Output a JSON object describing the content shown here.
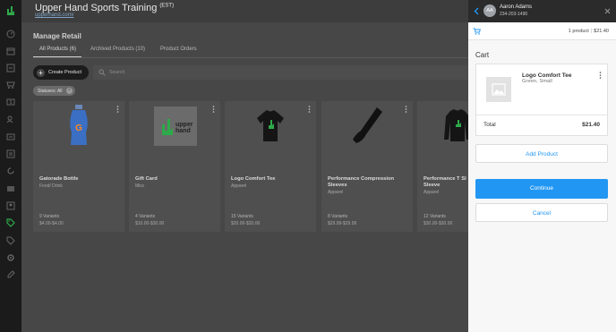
{
  "app": {
    "title": "Upper Hand Sports Training",
    "timezone": "(EST)",
    "url": "upperhand.com/"
  },
  "page": {
    "title": "Manage Retail",
    "tabs": [
      {
        "label": "All Products (6)",
        "active": true
      },
      {
        "label": "Archived Products (10)",
        "active": false
      },
      {
        "label": "Product Orders",
        "active": false
      }
    ],
    "create_button": "Create Product",
    "search_placeholder": "Search",
    "filter_chip": "Statuses: All"
  },
  "products": [
    {
      "name": "Gatorade Bottle",
      "category": "Food/ Drink",
      "variants": "9 Variants",
      "price": "$4.00-$4.00",
      "image": "bottle"
    },
    {
      "name": "Gift Card",
      "category": "Misc",
      "variants": "4 Variants",
      "price": "$10.00-$30.00",
      "image": "logo"
    },
    {
      "name": "Logo Comfort Tee",
      "category": "Apparel",
      "variants": "15 Variants",
      "price": "$20.00-$20.00",
      "image": "tee"
    },
    {
      "name": "Performance Compression Sleeves",
      "category": "Apparel",
      "variants": "8 Variants",
      "price": "$29.99-$29.99",
      "image": "sleeve"
    },
    {
      "name": "Performance T Sl Sleeve",
      "category": "Apparel",
      "variants": "12 Variants",
      "price": "$30.00-$30.00",
      "image": "longsleeve"
    }
  ],
  "drawer": {
    "customer": {
      "initials": "AA",
      "name": "Aaron Adams",
      "phone": "234-203-1490"
    },
    "summary": {
      "count": "1 product",
      "separator": "|",
      "total": "$21.40"
    },
    "cart_title": "Cart",
    "item": {
      "name": "Logo Comfort Tee",
      "variant": "Green, Small"
    },
    "total_label": "Total",
    "total_value": "$21.40",
    "add_product": "Add Product",
    "continue": "Continue",
    "cancel": "Cancel"
  },
  "colors": {
    "accent": "#2196f3",
    "brand_green": "#2eaa4a"
  }
}
